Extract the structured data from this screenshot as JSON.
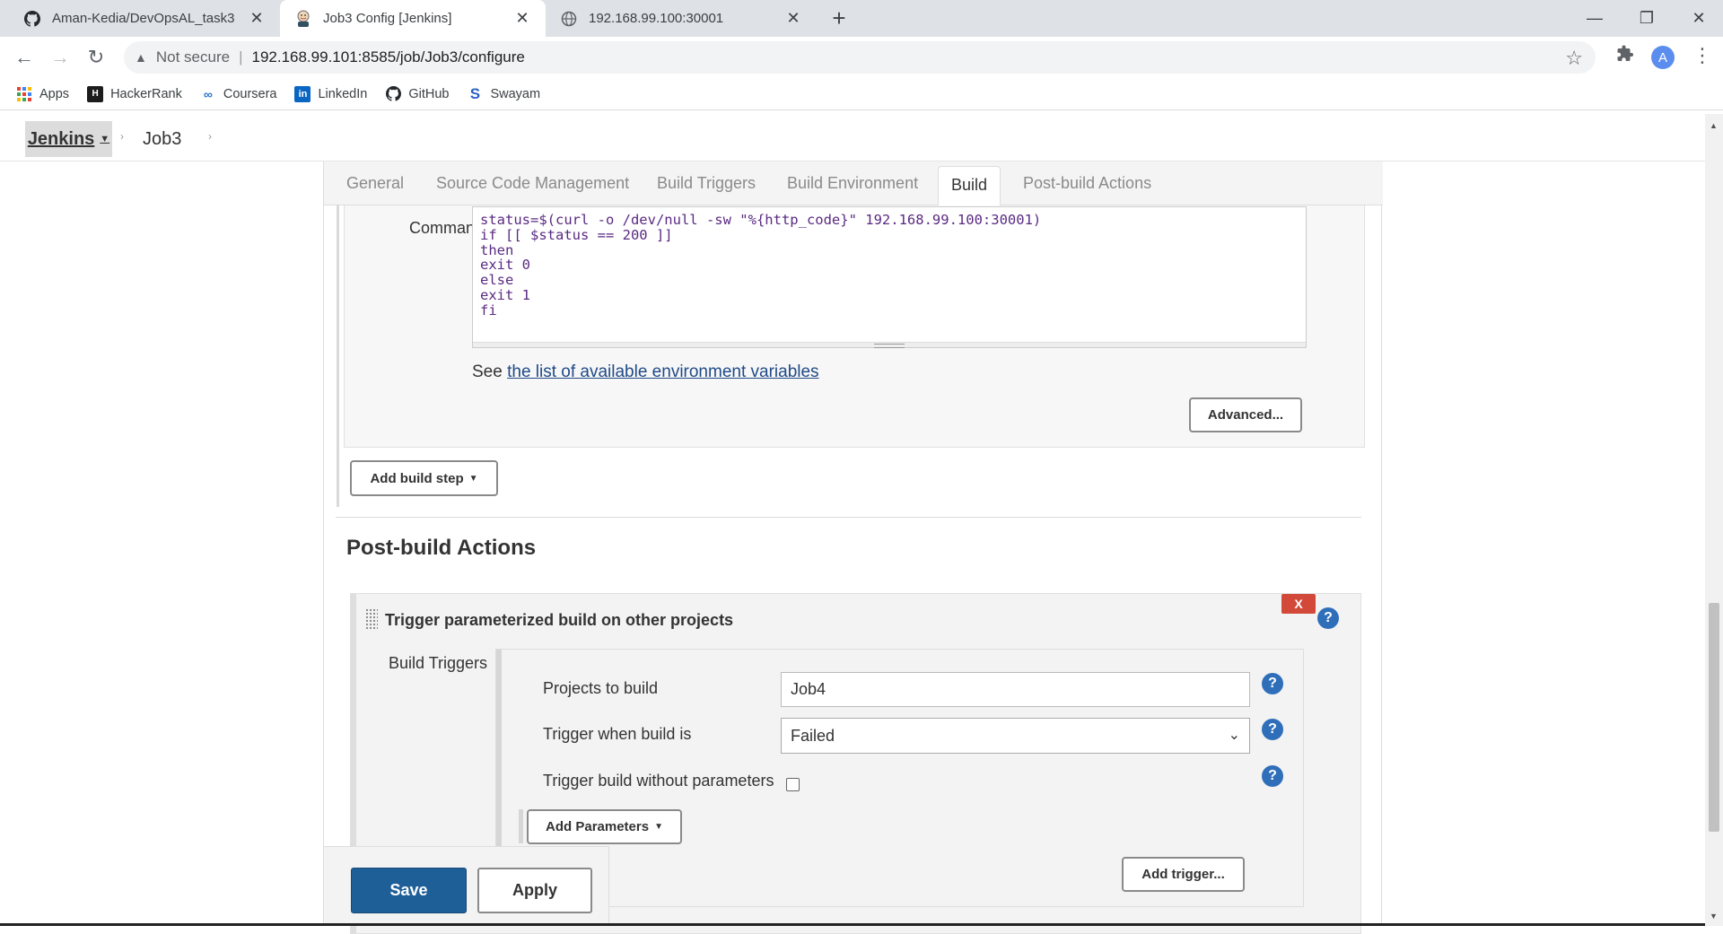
{
  "browser": {
    "tabs": [
      {
        "title": "Aman-Kedia/DevOpsAL_task3",
        "icon": "github-icon",
        "active": false
      },
      {
        "title": "Job3 Config [Jenkins]",
        "icon": "jenkins-icon",
        "active": true
      },
      {
        "title": "192.168.99.100:30001",
        "icon": "globe-icon",
        "active": false
      }
    ],
    "address": {
      "security_label": "Not secure",
      "url": "192.168.99.101:8585/job/Job3/configure"
    },
    "profile_initial": "A",
    "bookmarks": [
      {
        "label": "Apps",
        "icon": "apps-grid-icon"
      },
      {
        "label": "HackerRank",
        "icon": "hackerrank-icon"
      },
      {
        "label": "Coursera",
        "icon": "coursera-icon"
      },
      {
        "label": "LinkedIn",
        "icon": "linkedin-icon"
      },
      {
        "label": "GitHub",
        "icon": "github-icon"
      },
      {
        "label": "Swayam",
        "icon": "swayam-icon"
      }
    ]
  },
  "breadcrumbs": {
    "root": "Jenkins",
    "job": "Job3"
  },
  "config_tabs": [
    "General",
    "Source Code Management",
    "Build Triggers",
    "Build Environment",
    "Build",
    "Post-build Actions"
  ],
  "active_tab": "Build",
  "build": {
    "command_label": "Command",
    "command": "status=$(curl -o /dev/null -sw \"%{http_code}\" 192.168.99.100:30001)\nif [[ $status == 200 ]]\nthen\nexit 0\nelse\nexit 1\nfi",
    "env_prefix": "See ",
    "env_link": "the list of available environment variables",
    "advanced_button": "Advanced...",
    "add_build_step": "Add build step"
  },
  "post_build": {
    "heading": "Post-build Actions",
    "delete_label": "X",
    "trigger_title": "Trigger parameterized build on other projects",
    "build_triggers_label": "Build Triggers",
    "projects_label": "Projects to build",
    "projects_value": "Job4",
    "trigger_when_label": "Trigger when build is",
    "trigger_when_value": "Failed",
    "without_params_label": "Trigger build without parameters",
    "without_params_checked": false,
    "add_parameters": "Add Parameters",
    "add_trigger": "Add trigger..."
  },
  "footer": {
    "save": "Save",
    "apply": "Apply"
  },
  "colors": {
    "save_button": "#1f5f98",
    "delete_button": "#d24939",
    "help_icon": "#2f6fba",
    "link": "#204a87"
  }
}
